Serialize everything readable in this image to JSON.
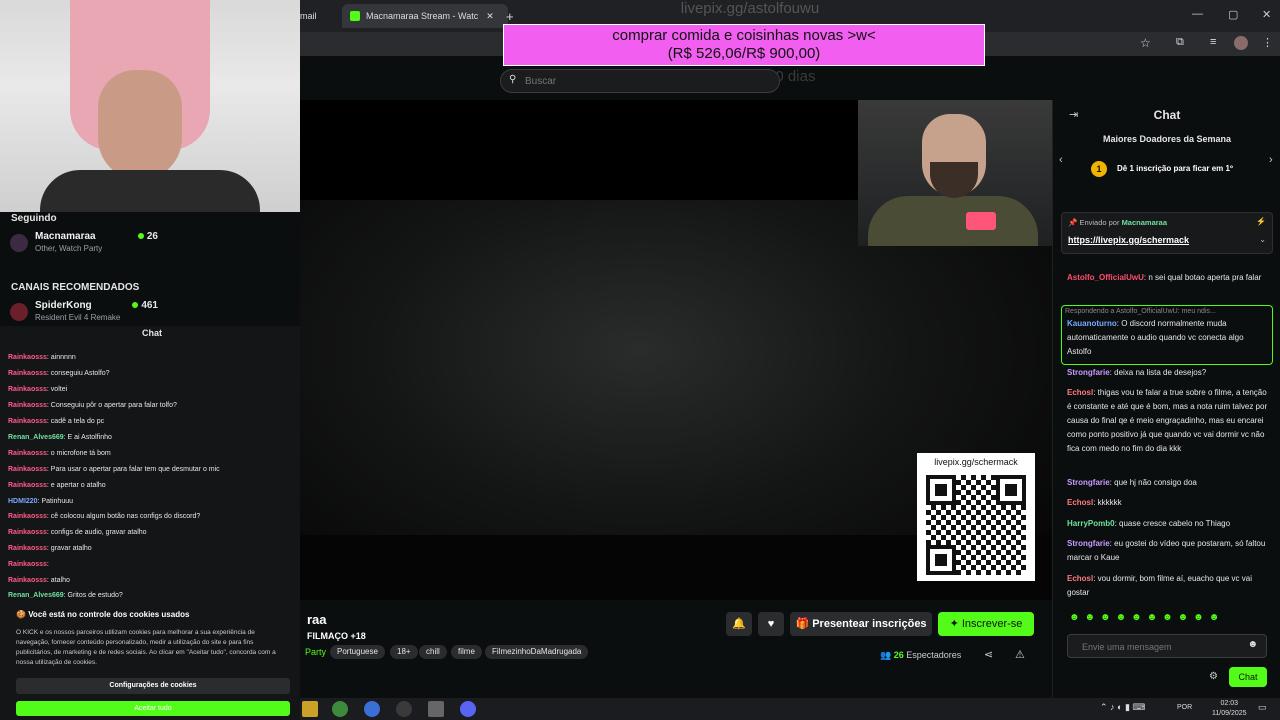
{
  "browser": {
    "tab_left": "mail",
    "tab_active": "Macnamaraa Stream - Watc",
    "new_tab": "+",
    "close": "✕",
    "minimize": "—",
    "maximize": "▢",
    "win_close": "✕"
  },
  "banner": {
    "line1": "comprar comida e coisinhas novas >w<",
    "line2": "(R$ 526,06/R$ 900,00)",
    "ghost_url": "livepix.gg/astolfouwu",
    "ghost_days": "Termina em 20 dias"
  },
  "search": {
    "placeholder": "Buscar"
  },
  "sidebar": {
    "following_title": "Seguindo",
    "following": {
      "name": "Macnamaraa",
      "category": "Other, Watch Party",
      "viewers": "26"
    },
    "recommended_title": "CANAIS RECOMENDADOS",
    "recommended": {
      "name": "SpiderKong",
      "category": "Resident Evil 4 Remake",
      "viewers": "461"
    }
  },
  "left_chat": {
    "title": "Chat",
    "messages": [
      {
        "user": "Rainkaosss",
        "text": ": ainnnnn",
        "color": "pink"
      },
      {
        "user": "Rainkaosss",
        "text": ": conseguiu Astolfo?",
        "color": "pink"
      },
      {
        "user": "Rainkaosss",
        "text": ": voltei",
        "color": "pink"
      },
      {
        "user": "Rainkaosss",
        "text": ": Conseguiu pôr o apertar para falar tolfo?",
        "color": "pink"
      },
      {
        "user": "Rainkaosss",
        "text": ": cadê a tela do pc",
        "color": "pink"
      },
      {
        "user": "Renan_Alves669",
        "text": ": E ai Astolfinho",
        "color": "green"
      },
      {
        "user": "Rainkaosss",
        "text": ": o microfone tá bom",
        "color": "pink"
      },
      {
        "user": "Rainkaosss",
        "text": ": Para usar o apertar para falar tem que desmutar o mic",
        "color": "pink"
      },
      {
        "user": "Rainkaosss",
        "text": ": e apertar o atalho",
        "color": "pink"
      },
      {
        "user": "HDMI220",
        "text": ": Patinhuuu",
        "color": "blue"
      },
      {
        "user": "Rainkaosss",
        "text": ": cê colocou algum botão nas configs do discord?",
        "color": "pink"
      },
      {
        "user": "Rainkaosss",
        "text": ": configs de audio, gravar atalho",
        "color": "pink"
      },
      {
        "user": "Rainkaosss",
        "text": ": gravar atalho",
        "color": "pink"
      },
      {
        "user": "Rainkaosss",
        "text": ":",
        "color": "pink"
      },
      {
        "user": "Rainkaosss",
        "text": ": atalho",
        "color": "pink"
      },
      {
        "user": "Renan_Alves669",
        "text": ": Gritos de estudo?",
        "color": "green"
      }
    ]
  },
  "cookies": {
    "title": "Você está no controle dos cookies usados",
    "text": "O KICK e os nossos parceiros utilizam cookies para melhorar a sua experiência de navegação, fornecer conteúdo personalizado, medir a utilização do site e para fins publicitários, de marketing e de redes sociais. Ao clicar em \"Aceitar tudo\", concorda com a nossa utilização de cookies.",
    "config_label": "Configurações de cookies",
    "accept_label": "Aceitar tudo"
  },
  "video": {
    "qr_label": "livepix.gg/schermack"
  },
  "stream": {
    "title": "raa",
    "subtitle": "FILMAÇO +18",
    "category": "Party",
    "tags": [
      "Portuguese",
      "18+",
      "chill",
      "filme",
      "FilmezinhoDaMadrugada"
    ],
    "bell_icon": "🔔",
    "heart_icon": "♥",
    "gift_label": "Presentear inscrições",
    "subscribe_label": "Inscrever-se",
    "viewers_count": "26",
    "viewers_label": "Espectadores"
  },
  "chat": {
    "title": "Chat",
    "donors_title": "Maiores Doadores da Semana",
    "donors_rank": "1",
    "donors_text": "Dê 1 inscrição para ficar em 1º",
    "pinned_prefix": "Enviado por",
    "pinned_user": "Macnamaraa",
    "pinned_link": "https://livepix.gg/schermack",
    "reply_head": "Respondendo a Astolfo_OfficialUwU: meu ndis...",
    "messages": [
      {
        "user": "Astolfo_OfficialUwU",
        "text": ": n sei qual botao aperta pra falar",
        "color": "#ff4d6d"
      },
      {
        "user": "Kauanoturno",
        "text": ": O discord normalmente muda automaticamente o audio quando vc conecta algo Astolfo",
        "color": "#7aa9ff"
      },
      {
        "user": "Strongfarie",
        "text": ": deixa na lista de desejos?",
        "color": "#c99bff"
      },
      {
        "user": "Echosl",
        "text": ": thigas vou te falar a true sobre o filme, a tenção é constante e até que é bom, mas a nota ruim talvez por causa do final qe é meio engraçadinho, mas eu encarei como ponto positivo já que quando vc vai dormir vc não fica com medo no fim do dia kkk",
        "color": "#ff7a7a"
      },
      {
        "user": "Strongfarie",
        "text": ": que hj não consigo doa",
        "color": "#c99bff"
      },
      {
        "user": "Echosl",
        "text": ": kkkkkk",
        "color": "#ff7a7a"
      },
      {
        "user": "HarryPomb0",
        "text": ": quase cresce cabelo no Thiago",
        "color": "#70e0a0"
      },
      {
        "user": "Strongfarie",
        "text": ": eu gostei do vídeo que postaram, só faltou marcar o Kaue",
        "color": "#c99bff"
      },
      {
        "user": "Echosl",
        "text": ": vou dormir, bom filme aí, euacho que vc vai gostar",
        "color": "#ff7a7a"
      }
    ],
    "emotes": "☻☻☻☻☻☻☻☻☻☻",
    "input_placeholder": "Envie uma mensagem",
    "send_label": "Chat"
  },
  "taskbar": {
    "lang": "POR",
    "time": "02:03",
    "date": "11/09/2025"
  }
}
